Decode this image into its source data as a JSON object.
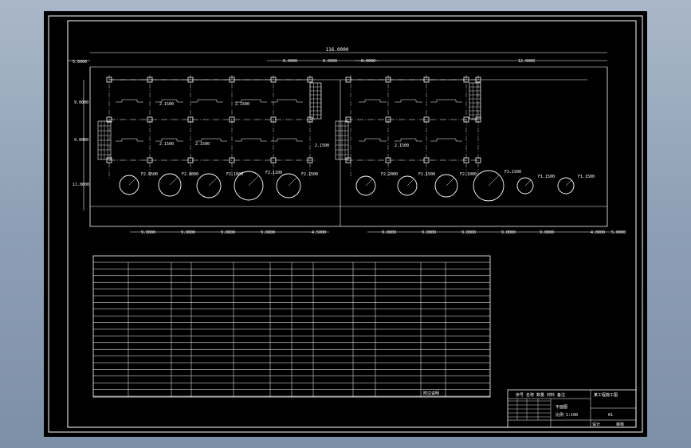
{
  "drawing": {
    "overall_dim": "116.0000",
    "left_offset_dim": "5.0000",
    "top_dims_left": [
      "8.0000",
      "8.0000"
    ],
    "top_dims_right": [
      "8.0000",
      "12.0000"
    ],
    "row_dims": [
      "9.0000",
      "9.0000",
      "11.0000"
    ],
    "bottom_dims_left": [
      "9.0000",
      "9.0000",
      "9.0000",
      "9.0000",
      "4.5000"
    ],
    "bottom_dims_right": [
      "9.0000",
      "9.0000",
      "9.0000",
      "9.0000",
      "9.0000",
      "4.0000",
      "5.0000"
    ],
    "pipe_length_labels": [
      "2.1500",
      "2.1500",
      "2.1500",
      "2.1500",
      "2.1500",
      "2.1500"
    ],
    "circle_labels_left": [
      "F2.0500",
      "F2.0000",
      "F2.1000",
      "F2.1100",
      "F2.1500"
    ],
    "circle_labels_right": [
      "F2.2000",
      "F2.1500",
      "F2.1000",
      "F2.1500",
      "F1.1500",
      "F1.1500"
    ]
  },
  "table": {
    "footer_note": "附注说明"
  },
  "title_block": {
    "header_row": "序号 名称 数量 材料 备注",
    "project": "某工程施工图",
    "drawing_name": "平面图",
    "scale": "比例 1:100",
    "sheet": "01",
    "footer_left": "设计",
    "footer_right": "审核"
  }
}
